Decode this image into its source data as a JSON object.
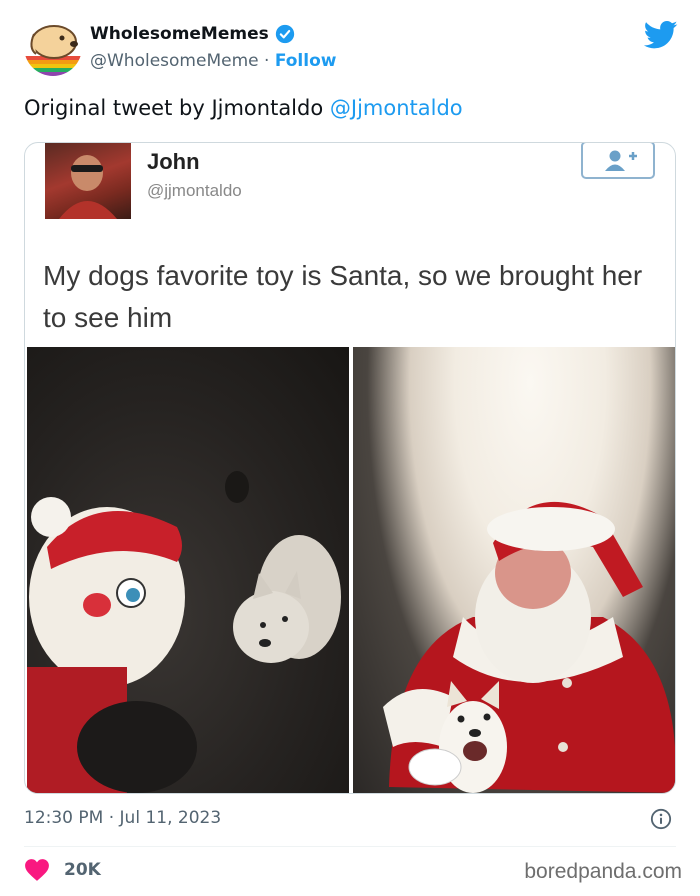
{
  "header": {
    "display_name": "WholesomeMemes",
    "handle": "@WholesomeMeme",
    "separator": "·",
    "follow_label": "Follow"
  },
  "tweet": {
    "text_prefix": "Original tweet by Jjmontaldo ",
    "mention": "@Jjmontaldo"
  },
  "embedded": {
    "name": "John",
    "handle": "@jjmontaldo",
    "text": "My dogs favorite toy is Santa, so we brought her to see him"
  },
  "footer": {
    "timestamp": "12:30 PM · Jul 11, 2023",
    "likes": "20K",
    "watermark": "boredpanda.com"
  },
  "colors": {
    "accent": "#1d9bf0",
    "like": "#f91880",
    "muted": "#536471"
  }
}
